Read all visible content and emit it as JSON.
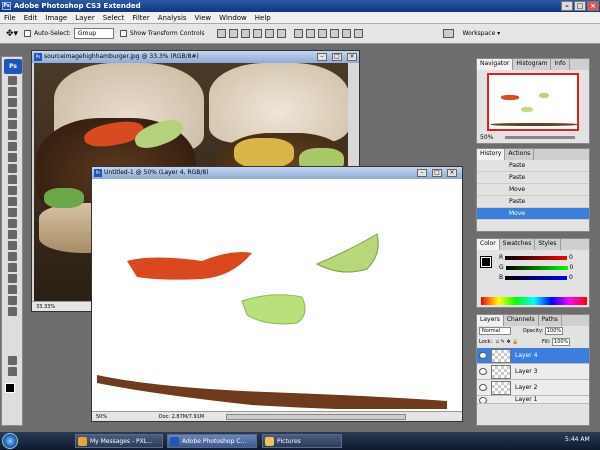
{
  "app": {
    "title": "Adobe Photoshop CS3 Extended",
    "icon_text": "Ps"
  },
  "window_controls": {
    "minimize": "–",
    "maximize": "□",
    "close": "×"
  },
  "menu": [
    "File",
    "Edit",
    "Image",
    "Layer",
    "Select",
    "Filter",
    "Analysis",
    "View",
    "Window",
    "Help"
  ],
  "options": {
    "auto_select_label": "Auto-Select:",
    "auto_select_value": "Group",
    "show_transform_label": "Show Transform Controls",
    "workspace_label": "Workspace ▾"
  },
  "toolbox": {
    "logo": "Ps"
  },
  "doc1": {
    "title": "sourceimagehighhamburger.jpg @ 33.3% (RGB/8#)",
    "zoom": "33.33%"
  },
  "doc2": {
    "title": "Untitled-1 @ 50% (Layer 4, RGB/8)",
    "zoom": "50%",
    "doc_info": "Doc: 2.87M/7.91M"
  },
  "navigator": {
    "tabs": [
      "Navigator",
      "Histogram",
      "Info"
    ],
    "zoom": "50%"
  },
  "history": {
    "tabs": [
      "History",
      "Actions"
    ],
    "items": [
      "Paste",
      "Paste",
      "Move",
      "Paste",
      "Move"
    ]
  },
  "color": {
    "tabs": [
      "Color",
      "Swatches",
      "Styles"
    ],
    "channels": [
      {
        "name": "R",
        "value": "0"
      },
      {
        "name": "G",
        "value": "0"
      },
      {
        "name": "B",
        "value": "0"
      }
    ]
  },
  "layers": {
    "tabs": [
      "Layers",
      "Channels",
      "Paths"
    ],
    "blend_mode": "Normal",
    "opacity_label": "Opacity:",
    "opacity": "100%",
    "lock_label": "Lock:",
    "fill_label": "Fill:",
    "fill": "100%",
    "items": [
      "Layer 4",
      "Layer 3",
      "Layer 2",
      "Layer 1"
    ]
  },
  "taskbar": {
    "tasks": [
      "My Messages - PXL...",
      "Adobe Photoshop C...",
      "Pictures"
    ],
    "clock": "5:44 AM"
  },
  "colors": {
    "accent": "#3c7edb",
    "titlebar": "#10357e"
  }
}
